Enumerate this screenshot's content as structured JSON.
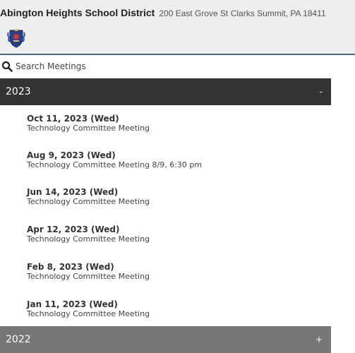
{
  "header": {
    "district_name": "Abington Heights School District",
    "address": "200 East Grove St Clarks Summit, PA 18411",
    "logo_icon": "district-crest-icon"
  },
  "search": {
    "label": "Search Meetings",
    "icon": "search-icon"
  },
  "years": [
    {
      "label": "2023",
      "toggle": "-",
      "expanded": true,
      "meetings": [
        {
          "date": "Oct 11, 2023 (Wed)",
          "title": "Technology Committee Meeting"
        },
        {
          "date": "Aug 9, 2023 (Wed)",
          "title": "Technology Committee Meeting 8/9, 6:30 pm"
        },
        {
          "date": "Jun 14, 2023 (Wed)",
          "title": "Technology Committee Meeting"
        },
        {
          "date": "Apr 12, 2023 (Wed)",
          "title": "Technology Committee Meeting"
        },
        {
          "date": "Feb 8, 2023 (Wed)",
          "title": "Technology Committee Meeting"
        },
        {
          "date": "Jan 11, 2023 (Wed)",
          "title": "Technology Committee Meeting"
        }
      ]
    },
    {
      "label": "2022",
      "toggle": "+",
      "expanded": false,
      "meetings": []
    }
  ],
  "colors": {
    "expanded_bar": "#333333",
    "collapsed_bar": "#777777",
    "header_bg": "#eeeeee",
    "header_border": "#4a6a8a"
  }
}
